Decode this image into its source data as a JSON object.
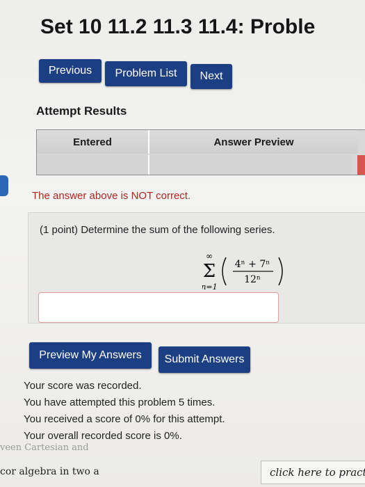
{
  "header": {
    "title": "Set 10 11.2 11.3 11.4: Proble"
  },
  "nav": {
    "previous": "Previous",
    "problem_list": "Problem List",
    "next": "Next"
  },
  "attempt": {
    "heading": "Attempt Results",
    "columns": [
      "Entered",
      "Answer Preview"
    ],
    "message": "The answer above is NOT correct."
  },
  "problem": {
    "text": "(1 point) Determine the sum of the following series.",
    "sum_upper": "∞",
    "sum_lower": "n=1",
    "numerator": "4ⁿ + 7ⁿ",
    "denominator": "12ⁿ",
    "answer_value": ""
  },
  "actions": {
    "preview": "Preview My Answers",
    "submit": "Submit Answers"
  },
  "score": {
    "line1": "Your score was recorded.",
    "line2": "You have attempted this problem 5 times.",
    "line3": "You received a score of 0% for this attempt.",
    "line4": "Your overall recorded score is 0%."
  },
  "footer": {
    "faded": "veen Cartesian and",
    "left": "cor algebra in two a",
    "right": "click here to practic"
  },
  "colors": {
    "button": "#1c3f84",
    "error": "#b3261e",
    "error_cell": "#d9534f"
  }
}
